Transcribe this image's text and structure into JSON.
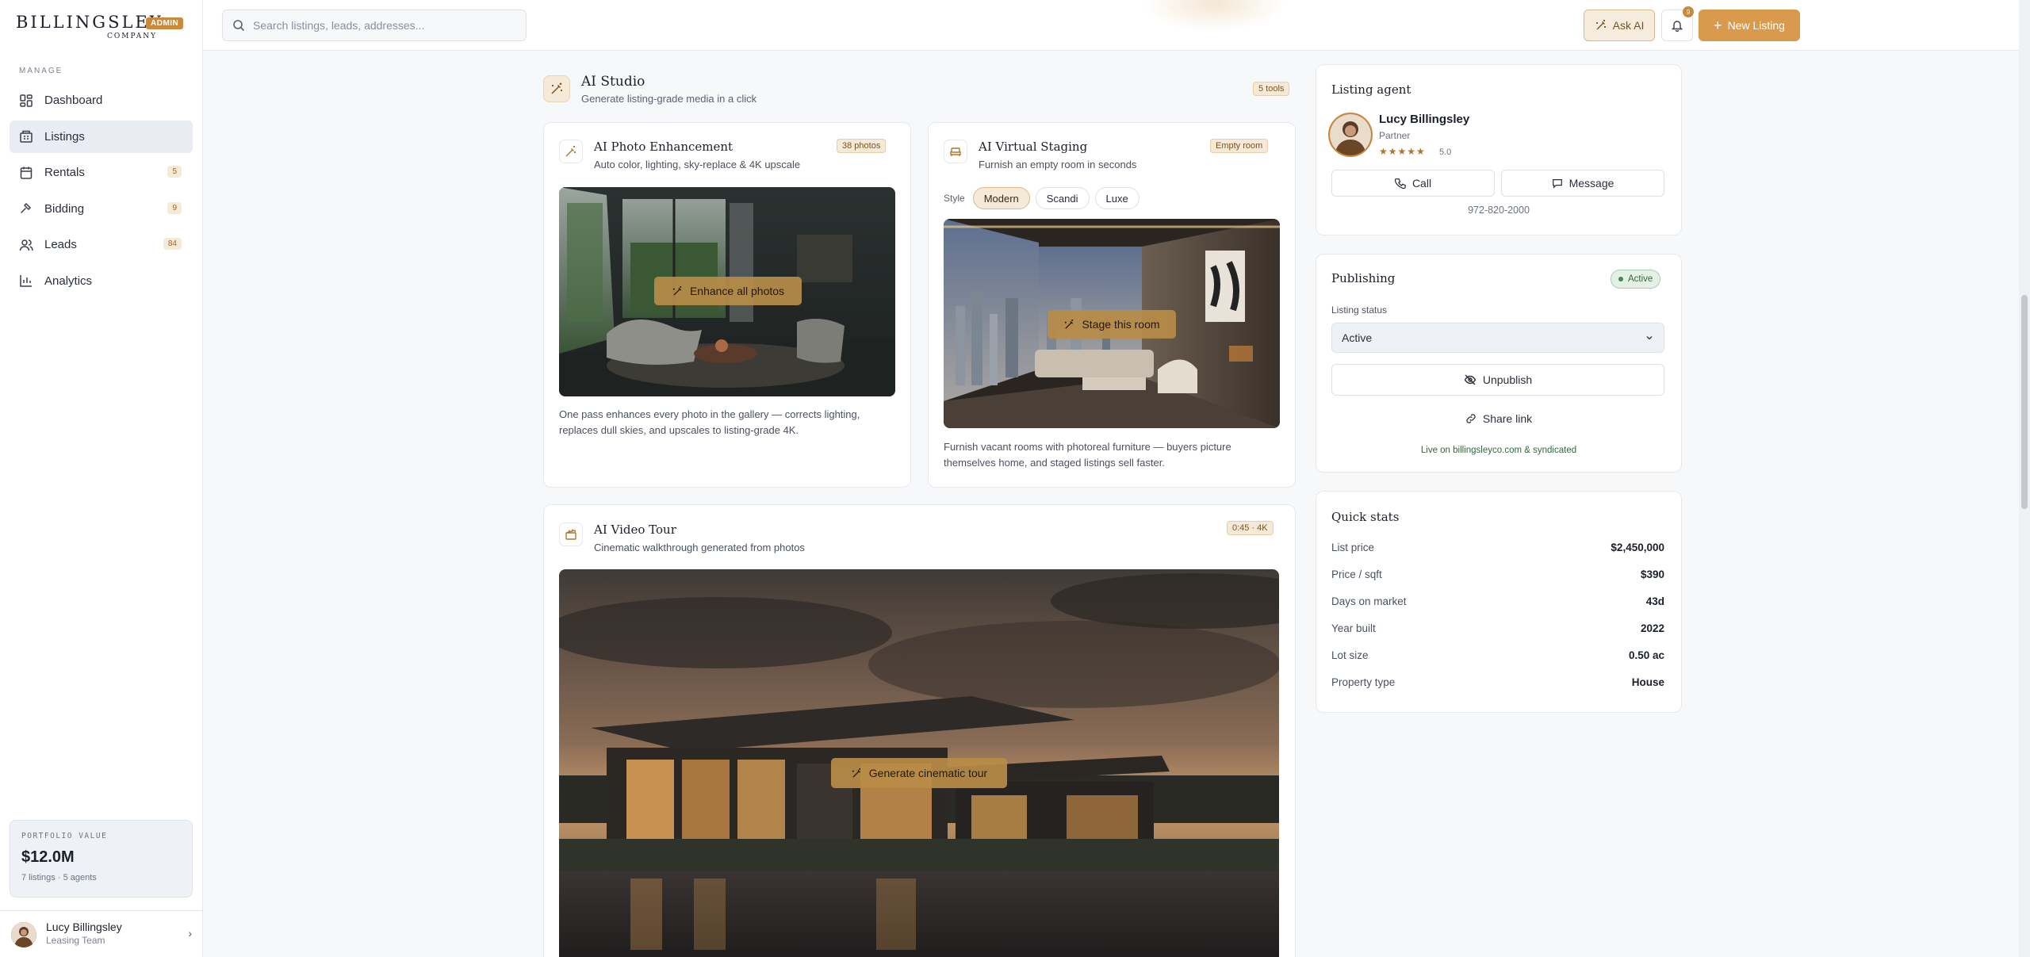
{
  "brand": {
    "name": "BILLINGSLEY",
    "sub": "COMPANY",
    "badge": "ADMIN"
  },
  "sidebar": {
    "section": "MANAGE",
    "items": [
      {
        "label": "Dashboard",
        "icon": "dashboard-icon",
        "count": ""
      },
      {
        "label": "Listings",
        "icon": "listings-icon",
        "count": "",
        "active": true
      },
      {
        "label": "Rentals",
        "icon": "rentals-icon",
        "count": "5"
      },
      {
        "label": "Bidding",
        "icon": "gavel-icon",
        "count": "9"
      },
      {
        "label": "Leads",
        "icon": "users-icon",
        "count": "84"
      },
      {
        "label": "Analytics",
        "icon": "chart-icon",
        "count": ""
      }
    ],
    "portfolio": {
      "label": "PORTFOLIO VALUE",
      "value": "$12.0M",
      "sub": "7 listings · 5 agents"
    },
    "user": {
      "name": "Lucy Billingsley",
      "role": "Leasing Team"
    }
  },
  "topbar": {
    "search_placeholder": "Search listings, leads, addresses...",
    "ask_ai": "Ask AI",
    "notifications": "9",
    "new_listing": "New Listing"
  },
  "studio": {
    "title": "AI Studio",
    "subtitle": "Generate listing-grade media in a click",
    "tools_tag": "5 tools",
    "enhance": {
      "title": "AI Photo Enhancement",
      "subtitle": "Auto color, lighting, sky-replace & 4K upscale",
      "tag": "38 photos",
      "button": "Enhance all photos",
      "desc1": "One pass enhances every photo in the gallery — corrects lighting,",
      "desc2": "replaces dull skies, and upscales to listing-grade 4K."
    },
    "staging": {
      "title": "AI Virtual Staging",
      "subtitle": "Furnish an empty room in seconds",
      "tag": "Empty room",
      "style_label": "Style",
      "styles": [
        "Modern",
        "Scandi",
        "Luxe"
      ],
      "selected_style": "Modern",
      "button": "Stage this room",
      "desc1": "Furnish vacant rooms with photoreal furniture — buyers picture",
      "desc2": "themselves home, and staged listings sell faster."
    },
    "video": {
      "title": "AI Video Tour",
      "subtitle": "Cinematic walkthrough generated from photos",
      "tag": "0:45 · 4K",
      "button": "Generate cinematic tour"
    }
  },
  "agent": {
    "panel_title": "Listing agent",
    "name": "Lucy Billingsley",
    "role": "Partner",
    "stars": "★★★★★",
    "rating": "5.0",
    "call": "Call",
    "message": "Message",
    "phone": "972-820-2000"
  },
  "publishing": {
    "title": "Publishing",
    "status_badge": "Active",
    "status_label": "Listing status",
    "status_value": "Active",
    "unpublish": "Unpublish",
    "share": "Share link",
    "note": "Live on billingsleyco.com & syndicated"
  },
  "quick_stats": {
    "title": "Quick stats",
    "rows": [
      {
        "k": "List price",
        "v": "$2,450,000"
      },
      {
        "k": "Price / sqft",
        "v": "$390"
      },
      {
        "k": "Days on market",
        "v": "43d"
      },
      {
        "k": "Year built",
        "v": "2022"
      },
      {
        "k": "Lot size",
        "v": "0.50 ac"
      },
      {
        "k": "Property type",
        "v": "House"
      }
    ]
  },
  "colors": {
    "accent": "#d99a4e",
    "gold": "#c98a3e",
    "active_nav": "#e9edf3"
  }
}
